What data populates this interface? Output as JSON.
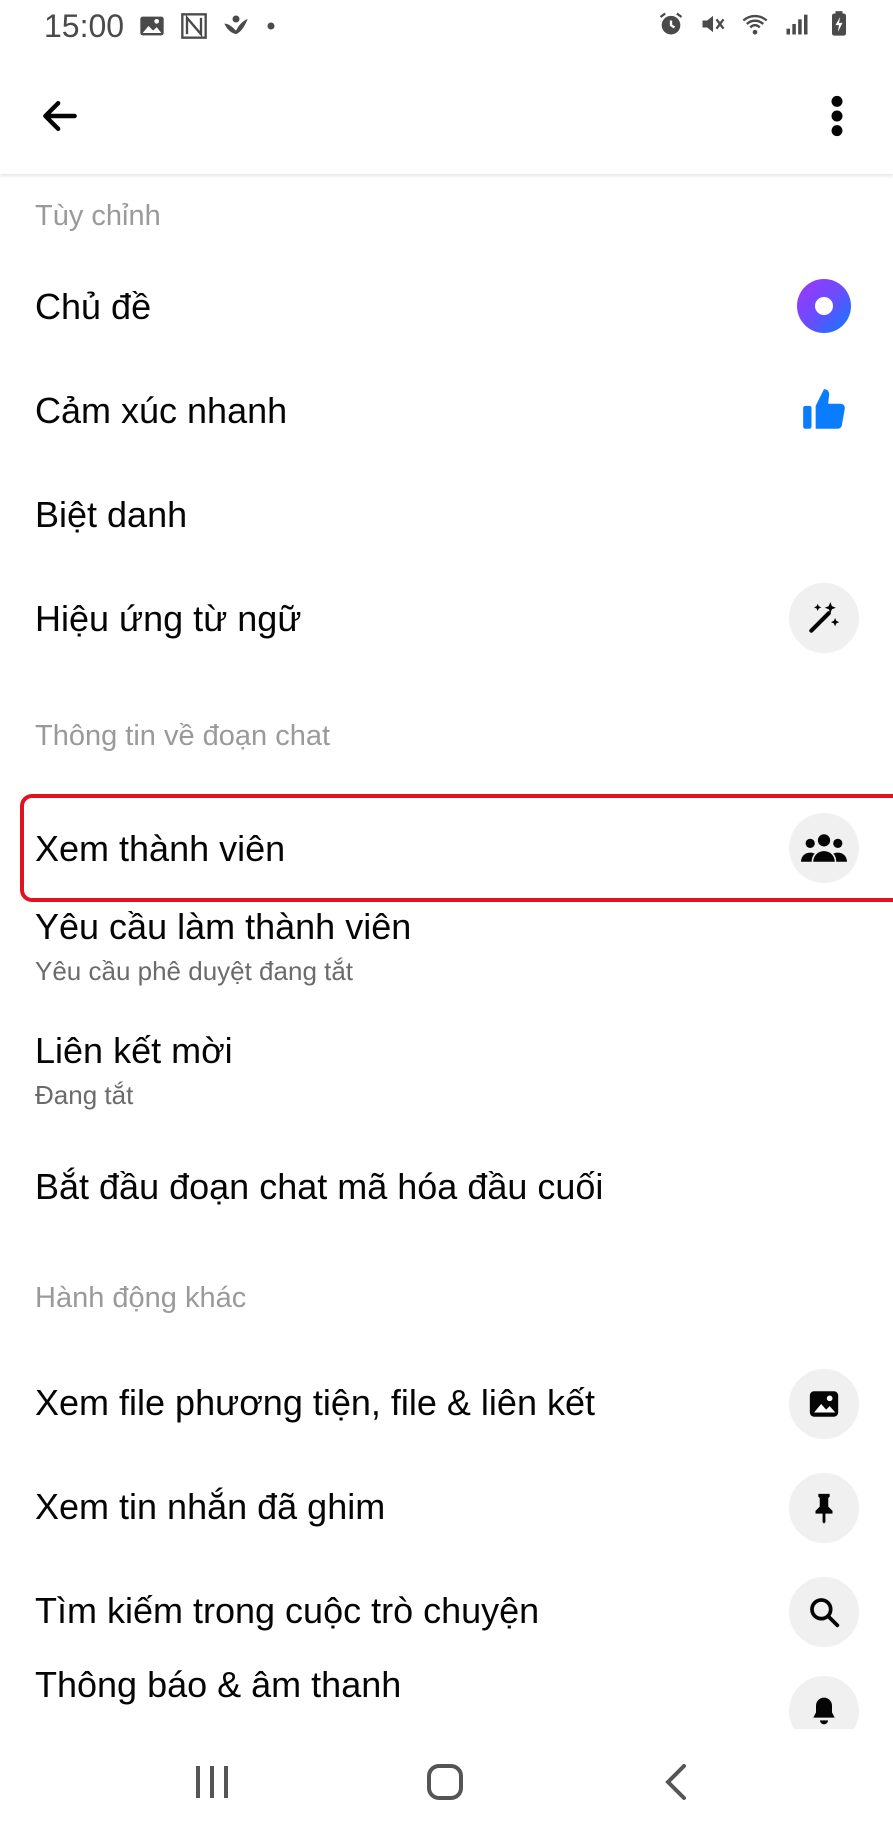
{
  "status": {
    "time": "15:00",
    "left_icons": [
      "image-icon",
      "n-app-icon",
      "bird-app-icon",
      "dot-icon"
    ],
    "right_icons": [
      "alarm-icon",
      "mute-icon",
      "wifi-icon",
      "signal-icon",
      "battery-charging-icon"
    ]
  },
  "appbar": {
    "back_icon": "arrow-left-icon",
    "more_icon": "more-vertical-icon"
  },
  "sections": {
    "customize": {
      "header": "Tùy chỉnh",
      "theme": "Chủ đề",
      "quick_reaction": "Cảm xúc nhanh",
      "nicknames": "Biệt danh",
      "word_effects": "Hiệu ứng từ ngữ"
    },
    "chat_info": {
      "header": "Thông tin về đoạn chat",
      "see_members": "Xem thành viên",
      "member_requests": "Yêu cầu làm thành viên",
      "member_requests_sub": "Yêu cầu phê duyệt đang tắt",
      "invite_link": "Liên kết mời",
      "invite_link_sub": "Đang tắt",
      "e2e_chat": "Bắt đầu đoạn chat mã hóa đầu cuối"
    },
    "other_actions": {
      "header": "Hành động khác",
      "view_media": "Xem file phương tiện, file & liên kết",
      "view_pinned": "Xem tin nhắn đã ghim",
      "search_conversation": "Tìm kiếm trong cuộc trò chuyện",
      "notifications": "Thông báo & âm thanh"
    }
  },
  "colors": {
    "accent": "#0a7cff",
    "highlight_border": "#e0141e",
    "section_header": "#9a9a9a",
    "icon_bg": "#f0f0f0"
  },
  "navbar": {
    "icons": [
      "recent-apps-icon",
      "home-icon",
      "back-icon"
    ]
  }
}
